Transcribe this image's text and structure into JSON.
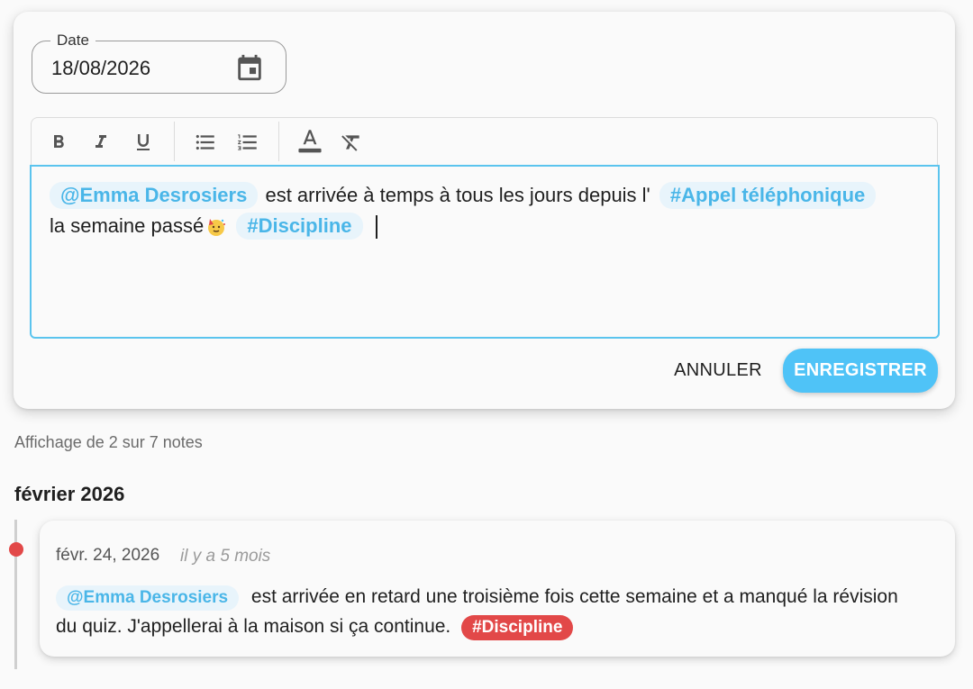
{
  "date_field": {
    "label": "Date",
    "value": "18/08/2026"
  },
  "toolbar": {
    "bold": "bold-icon",
    "italic": "italic-icon",
    "underline": "underline-icon",
    "bullet_list": "bullet-list-icon",
    "numbered_list": "numbered-list-icon",
    "text_color": "text-color-icon",
    "clear_format": "clear-format-icon"
  },
  "editor": {
    "mention": "@Emma Desrosiers",
    "text_1": "est arrivée à temps à tous les jours depuis l'",
    "tag_1": "#Appel téléphonique",
    "text_2": "la semaine passé",
    "emoji": "party-face-emoji",
    "tag_2": "#Discipline"
  },
  "actions": {
    "cancel": "ANNULER",
    "save": "ENREGISTRER"
  },
  "notes_count": "Affichage de 2 sur 7 notes",
  "month": "février 2026",
  "note": {
    "date": "févr. 24, 2026",
    "relative": "il y a 5 mois",
    "mention": "@Emma Desrosiers",
    "text": "est arrivée en retard une troisième fois cette semaine et a manqué la révision du quiz. J'appellerai à la maison si ça continue.",
    "tag": "#Discipline"
  },
  "colors": {
    "accent": "#4fc3f7",
    "focus_border": "#5bc4ee",
    "mention_bg": "#e8f4fb",
    "mention_text": "#4ab6e8",
    "tag_red": "#e24848",
    "timeline_dot": "#e24848"
  }
}
